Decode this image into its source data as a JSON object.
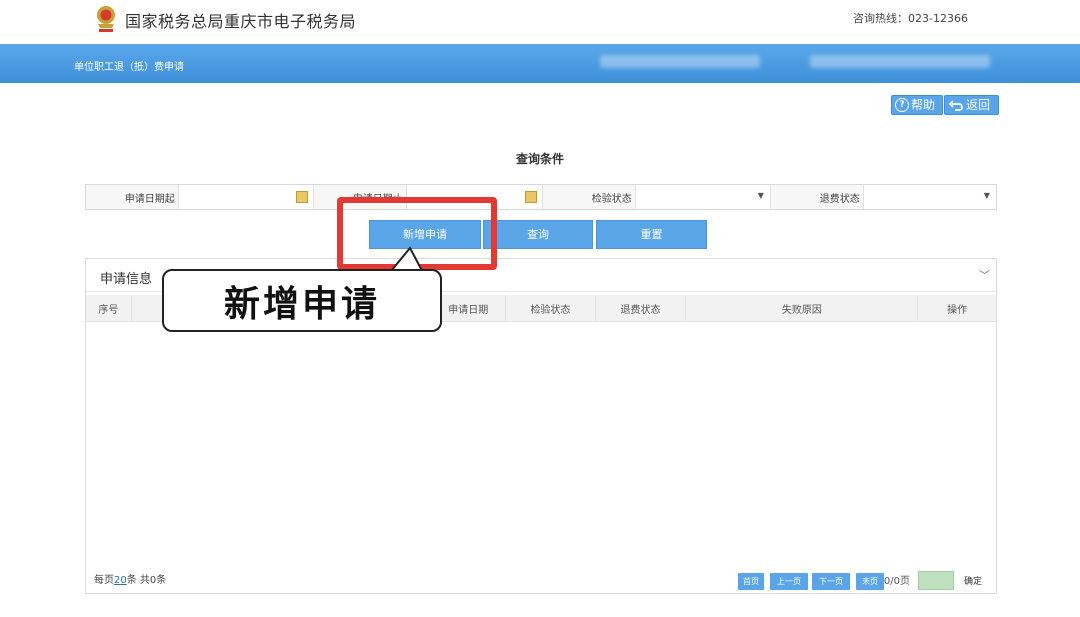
{
  "header": {
    "site_title": "国家税务总局重庆市电子税务局",
    "hotline": "咨询热线：023-12366"
  },
  "nav": {
    "breadcrumb": "单位职工退（抵）费申请"
  },
  "toolbar": {
    "help_label": "帮助",
    "back_label": "返回"
  },
  "query": {
    "title": "查询条件",
    "fields": [
      {
        "label": "申请日期起",
        "value": ""
      },
      {
        "label": "申请日期止",
        "value": ""
      },
      {
        "label": "检验状态",
        "value": ""
      },
      {
        "label": "退费状态",
        "value": ""
      }
    ]
  },
  "actions": {
    "add": "新增申请",
    "search": "查询",
    "reset": "重置"
  },
  "panel": {
    "title": "申请信息",
    "columns": [
      "序号",
      "",
      "申请日期",
      "检验状态",
      "退费状态",
      "失败原因",
      "操作"
    ],
    "rows": []
  },
  "pager": {
    "per_page_prefix": "每页",
    "per_page": "20",
    "per_page_suffix": "条 共0条",
    "first": "首页",
    "prev": "上一页",
    "next": "下一页",
    "last": "末页",
    "count": "0/0页",
    "confirm": "确定"
  },
  "annotation": {
    "callout_text": "新增申请"
  },
  "colors": {
    "accent": "#4a9ae2",
    "highlight": "#e23a32"
  }
}
